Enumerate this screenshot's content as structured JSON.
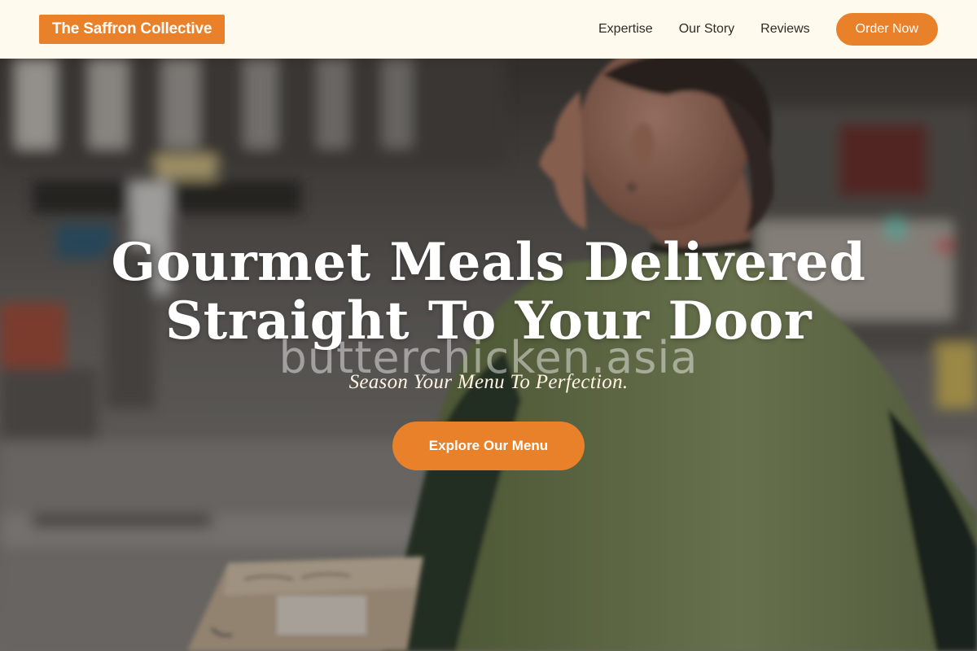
{
  "brand": {
    "name": "The Saffron Collective",
    "accent_color": "#e8812a",
    "header_background": "#fffaee"
  },
  "nav": {
    "links": [
      {
        "label": "Expertise"
      },
      {
        "label": "Our Story"
      },
      {
        "label": "Reviews"
      }
    ],
    "order_button": "Order Now"
  },
  "hero": {
    "headline_line1": "Gourmet Meals Delivered",
    "headline_line2": "Straight To Your Door",
    "watermark": "butterchicken.asia",
    "tagline": "Season Your Menu To Perfection.",
    "cta": "Explore Our Menu"
  }
}
